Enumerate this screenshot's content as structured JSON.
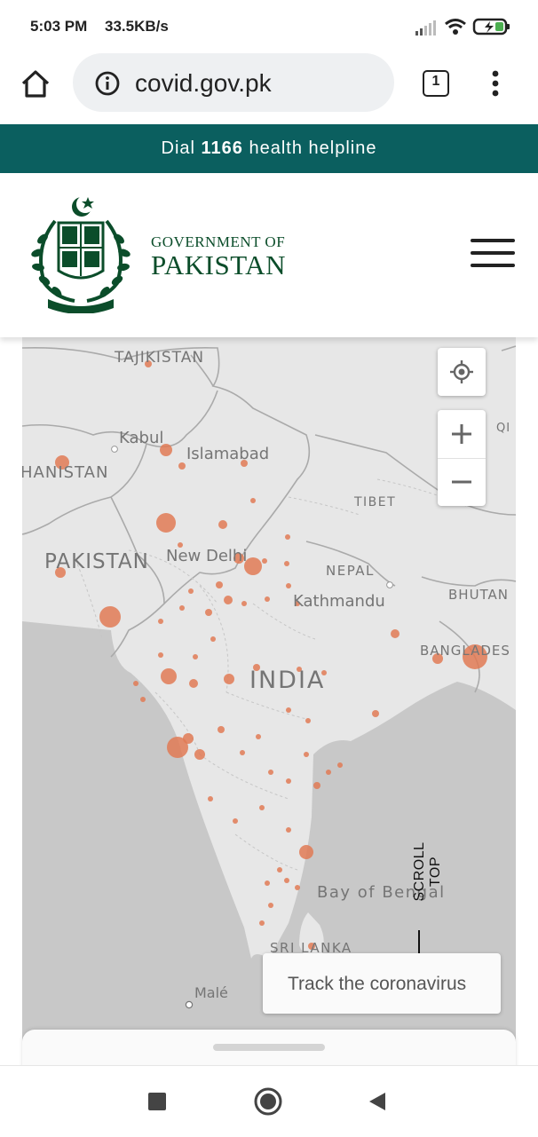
{
  "status_bar": {
    "time": "5:03 PM",
    "speed": "33.5KB/s"
  },
  "browser": {
    "url": "covid.gov.pk",
    "tab_count": "1"
  },
  "banner": {
    "prefix": "Dial",
    "number": "1166",
    "suffix": "health helpline"
  },
  "header": {
    "title_line1": "GOVERNMENT OF",
    "title_line2": "PAKISTAN"
  },
  "map": {
    "labels": {
      "tajikistan": "TAJIKISTAN",
      "kabul": "Kabul",
      "islamabad": "Islamabad",
      "afghanistan": "HANISTAN",
      "tibet": "TIBET",
      "pakistan": "PAKISTAN",
      "new_delhi": "New Delhi",
      "nepal": "NEPAL",
      "kathmandu": "Kathmandu",
      "bhutan": "BHUTAN",
      "bangladesh": "BANGLADES",
      "india": "INDIA",
      "bay_of_bengal": "Bay of Bengal",
      "sri_lanka": "SRI LANKA",
      "male": "Malé",
      "qi": "QI"
    }
  },
  "track_card": {
    "label": "Track the coronavirus"
  },
  "scroll_top": {
    "label": "SCROLL TOP"
  },
  "colors": {
    "banner_bg": "#0b5f5f",
    "brand_green": "#0b4d2a",
    "marker": "#e07a55",
    "water": "#c8c8c8",
    "land": "#e7e7e7"
  }
}
